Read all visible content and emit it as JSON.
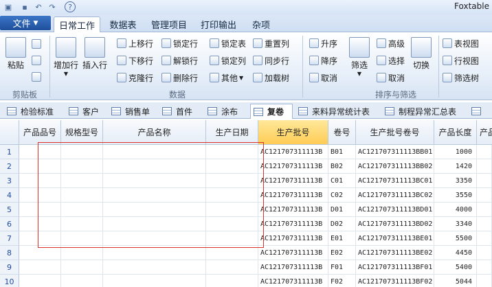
{
  "app_title": "Foxtable",
  "ribbon_tabs": {
    "file": "文件",
    "items": [
      "日常工作",
      "数据表",
      "管理项目",
      "打印输出",
      "杂项"
    ]
  },
  "clipboard": {
    "paste": "粘贴",
    "group": "剪贴板"
  },
  "data_group": {
    "add_row": "增加行",
    "insert_row": "插入行",
    "move_up": "上移行",
    "move_down": "下移行",
    "clone_row": "克隆行",
    "lock_row": "锁定行",
    "unlock_row": "解锁行",
    "delete_row": "删除行",
    "lock_table": "锁定表",
    "lock_col": "锁定列",
    "other": "其他",
    "reset_col": "重置列",
    "sync_col": "同步行",
    "load_tree": "加载树",
    "group": "数据"
  },
  "sort_group": {
    "asc": "升序",
    "desc": "降序",
    "cancel_sort": "取消",
    "filter": "筛选",
    "advanced": "高级",
    "select": "选择",
    "cancel_filter": "取消",
    "toggle": "切换",
    "table_view": "表视图",
    "row_view": "行视图",
    "filter_tree": "筛选树",
    "group": "排序与筛选"
  },
  "doc_tabs": [
    "检验标准",
    "客户",
    "销售单",
    "首件",
    "涂布",
    "复卷",
    "来料异常统计表",
    "制程异常汇总表"
  ],
  "columns": [
    "产品品号",
    "规格型号",
    "产品名称",
    "生产日期",
    "生产批号",
    "卷号",
    "生产批号卷号",
    "产品长度",
    "产品"
  ],
  "rows": [
    {
      "n": "1",
      "batch": "AC121707311113B",
      "roll": "B01",
      "batch_roll": "AC121707311113BB01",
      "len": "1000"
    },
    {
      "n": "2",
      "batch": "AC121707311113B",
      "roll": "B02",
      "batch_roll": "AC121707311113BB02",
      "len": "1420"
    },
    {
      "n": "3",
      "batch": "AC121707311113B",
      "roll": "C01",
      "batch_roll": "AC121707311113BC01",
      "len": "3350"
    },
    {
      "n": "4",
      "batch": "AC121707311113B",
      "roll": "C02",
      "batch_roll": "AC121707311113BC02",
      "len": "3550"
    },
    {
      "n": "5",
      "batch": "AC121707311113B",
      "roll": "D01",
      "batch_roll": "AC121707311113BD01",
      "len": "4000"
    },
    {
      "n": "6",
      "batch": "AC121707311113B",
      "roll": "D02",
      "batch_roll": "AC121707311113BD02",
      "len": "3340"
    },
    {
      "n": "7",
      "batch": "AC121707311113B",
      "roll": "E01",
      "batch_roll": "AC121707311113BE01",
      "len": "5500"
    },
    {
      "n": "8",
      "batch": "AC121707311113B",
      "roll": "E02",
      "batch_roll": "AC121707311113BE02",
      "len": "4450"
    },
    {
      "n": "9",
      "batch": "AC121707311113B",
      "roll": "F01",
      "batch_roll": "AC121707311113BF01",
      "len": "5400"
    },
    {
      "n": "10",
      "batch": "AC121707311113B",
      "roll": "F02",
      "batch_roll": "AC121707311113BF02",
      "len": "5044"
    }
  ]
}
